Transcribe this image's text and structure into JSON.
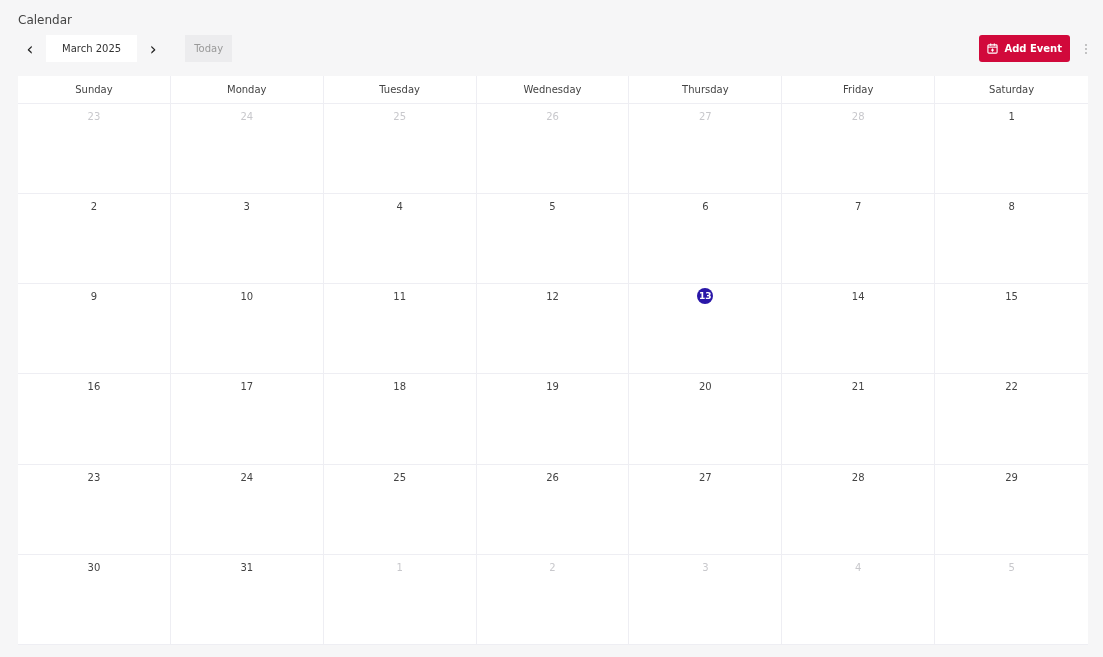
{
  "title": "Calendar",
  "toolbar": {
    "prev": "‹",
    "month": "March 2025",
    "next": "›",
    "today": "Today",
    "add_event": "Add Event"
  },
  "weekdays": [
    "Sunday",
    "Monday",
    "Tuesday",
    "Wednesday",
    "Thursday",
    "Friday",
    "Saturday"
  ],
  "weeks": [
    [
      {
        "day": "23",
        "in_month": false,
        "today": false
      },
      {
        "day": "24",
        "in_month": false,
        "today": false
      },
      {
        "day": "25",
        "in_month": false,
        "today": false
      },
      {
        "day": "26",
        "in_month": false,
        "today": false
      },
      {
        "day": "27",
        "in_month": false,
        "today": false
      },
      {
        "day": "28",
        "in_month": false,
        "today": false
      },
      {
        "day": "1",
        "in_month": true,
        "today": false
      }
    ],
    [
      {
        "day": "2",
        "in_month": true,
        "today": false
      },
      {
        "day": "3",
        "in_month": true,
        "today": false
      },
      {
        "day": "4",
        "in_month": true,
        "today": false
      },
      {
        "day": "5",
        "in_month": true,
        "today": false
      },
      {
        "day": "6",
        "in_month": true,
        "today": false
      },
      {
        "day": "7",
        "in_month": true,
        "today": false
      },
      {
        "day": "8",
        "in_month": true,
        "today": false
      }
    ],
    [
      {
        "day": "9",
        "in_month": true,
        "today": false
      },
      {
        "day": "10",
        "in_month": true,
        "today": false
      },
      {
        "day": "11",
        "in_month": true,
        "today": false
      },
      {
        "day": "12",
        "in_month": true,
        "today": false
      },
      {
        "day": "13",
        "in_month": true,
        "today": true
      },
      {
        "day": "14",
        "in_month": true,
        "today": false
      },
      {
        "day": "15",
        "in_month": true,
        "today": false
      }
    ],
    [
      {
        "day": "16",
        "in_month": true,
        "today": false
      },
      {
        "day": "17",
        "in_month": true,
        "today": false
      },
      {
        "day": "18",
        "in_month": true,
        "today": false
      },
      {
        "day": "19",
        "in_month": true,
        "today": false
      },
      {
        "day": "20",
        "in_month": true,
        "today": false
      },
      {
        "day": "21",
        "in_month": true,
        "today": false
      },
      {
        "day": "22",
        "in_month": true,
        "today": false
      }
    ],
    [
      {
        "day": "23",
        "in_month": true,
        "today": false
      },
      {
        "day": "24",
        "in_month": true,
        "today": false
      },
      {
        "day": "25",
        "in_month": true,
        "today": false
      },
      {
        "day": "26",
        "in_month": true,
        "today": false
      },
      {
        "day": "27",
        "in_month": true,
        "today": false
      },
      {
        "day": "28",
        "in_month": true,
        "today": false
      },
      {
        "day": "29",
        "in_month": true,
        "today": false
      }
    ],
    [
      {
        "day": "30",
        "in_month": true,
        "today": false
      },
      {
        "day": "31",
        "in_month": true,
        "today": false
      },
      {
        "day": "1",
        "in_month": false,
        "today": false
      },
      {
        "day": "2",
        "in_month": false,
        "today": false
      },
      {
        "day": "3",
        "in_month": false,
        "today": false
      },
      {
        "day": "4",
        "in_month": false,
        "today": false
      },
      {
        "day": "5",
        "in_month": false,
        "today": false
      }
    ]
  ]
}
